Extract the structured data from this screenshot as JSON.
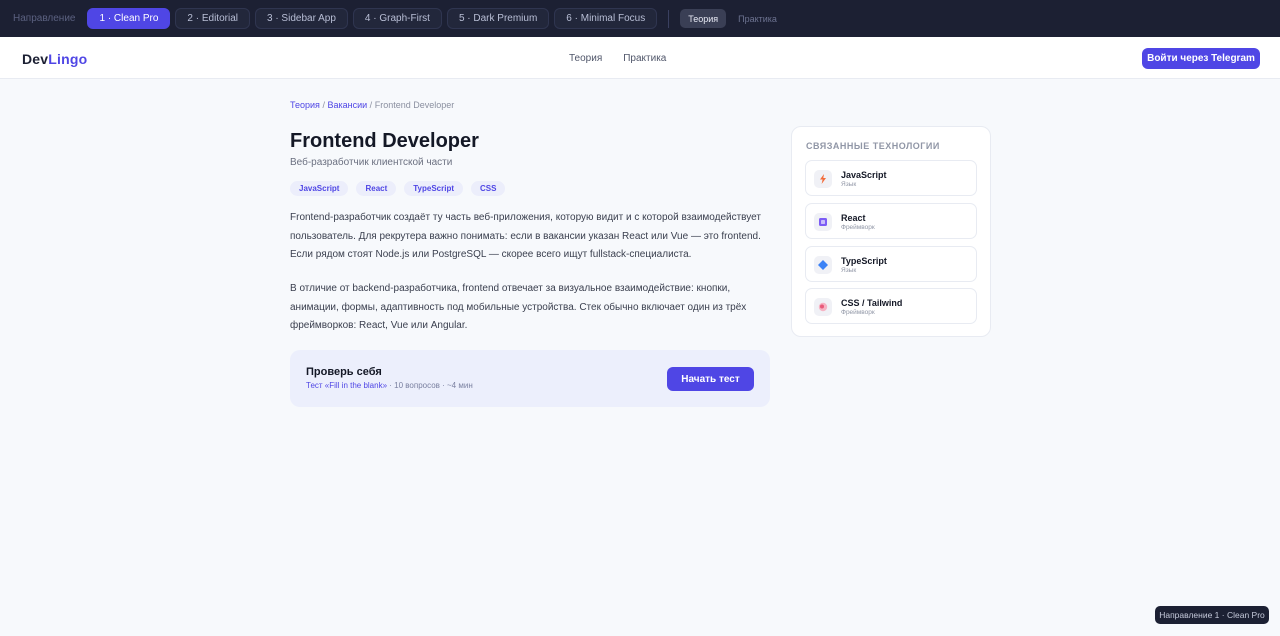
{
  "dirbar": {
    "label": "Направление",
    "pills": [
      "1 · Clean Pro",
      "2 · Editorial",
      "3 · Sidebar App",
      "4 · Graph-First",
      "5 · Dark Premium",
      "6 · Minimal Focus"
    ],
    "active_pill": 0,
    "modes": [
      "Теория",
      "Практика"
    ],
    "active_mode": 0
  },
  "header": {
    "logo_part1": "Dev",
    "logo_part2": "Lingo",
    "nav": [
      "Теория",
      "Практика"
    ],
    "login_button": "Войти через Telegram"
  },
  "breadcrumb": {
    "items": [
      "Теория",
      "Вакансии"
    ],
    "current": "Frontend Developer",
    "separator": "/"
  },
  "main": {
    "title": "Frontend Developer",
    "subtitle": "Веб-разработчик клиентской части",
    "tags": [
      "JavaScript",
      "React",
      "TypeScript",
      "CSS"
    ],
    "paragraph1": "Frontend-разработчик создаёт ту часть веб-приложения, которую видит и с которой взаимодействует пользователь. Для рекрутера важно понимать: если в вакансии указан React или Vue — это frontend. Если рядом стоят Node.js или PostgreSQL — скорее всего ищут fullstack-специалиста.",
    "paragraph2": "В отличие от backend-разработчика, frontend отвечает за визуальное взаимодействие: кнопки, анимации, формы, адаптивность под мобильные устройства. Стек обычно включает один из трёх фреймворков: React, Vue или Angular."
  },
  "quiz": {
    "title": "Проверь себя",
    "meta_link": "Тест «Fill in the blank»",
    "meta_rest": " · 10 вопросов · ~4 мин",
    "button": "Начать тест"
  },
  "related": {
    "heading": "СВЯЗАННЫЕ ТЕХНОЛОГИИ",
    "items": [
      {
        "name": "JavaScript",
        "kind": "Язык",
        "icon": "lightning-icon",
        "color": "#f26b3a"
      },
      {
        "name": "React",
        "kind": "Фреймворк",
        "icon": "cube-icon",
        "color": "#7c5cf5"
      },
      {
        "name": "TypeScript",
        "kind": "Язык",
        "icon": "diamond-icon",
        "color": "#3b82f6"
      },
      {
        "name": "CSS / Tailwind",
        "kind": "Фреймворк",
        "icon": "palette-icon",
        "color": "#e85a7a"
      }
    ]
  },
  "status_badge": "Направление 1 · Clean Pro"
}
